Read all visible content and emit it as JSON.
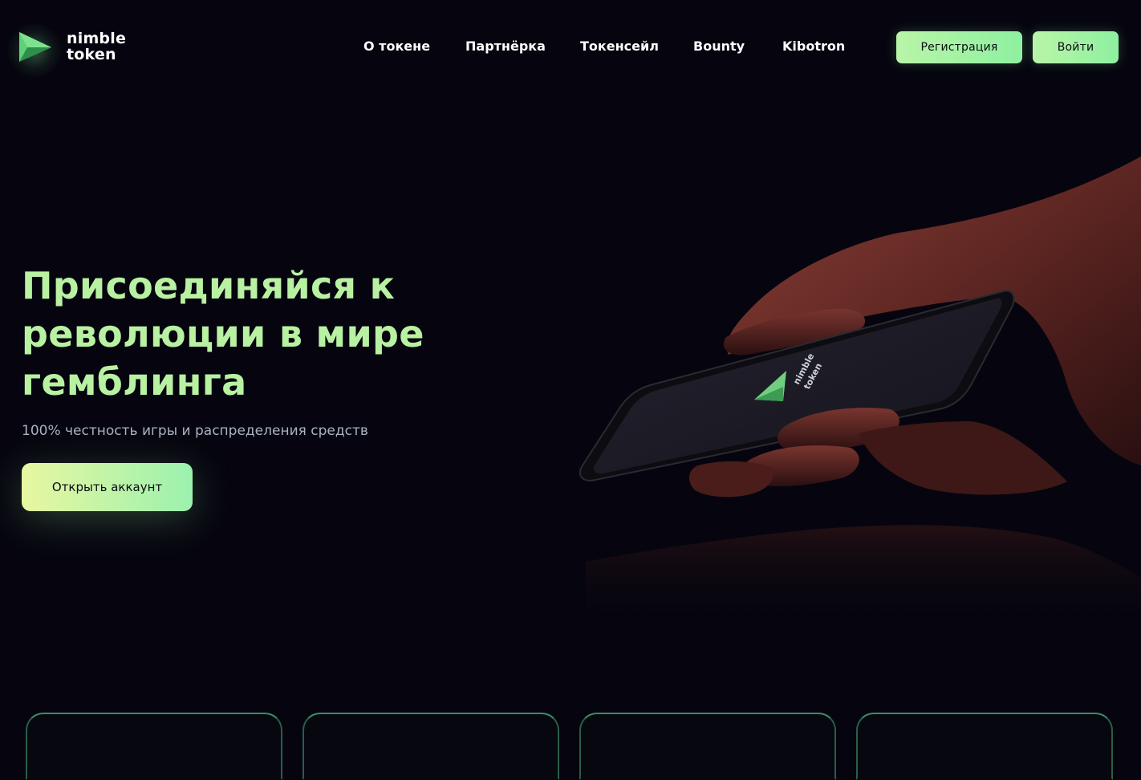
{
  "brand": {
    "name_line1": "nimble",
    "name_line2": "token",
    "logo_icon": "play-triangle-icon",
    "accent": "#8ef0a0"
  },
  "nav": {
    "items": [
      {
        "label": "О токене"
      },
      {
        "label": "Партнёрка"
      },
      {
        "label": "Токенсейл"
      },
      {
        "label": "Bounty"
      },
      {
        "label": "Kibotron"
      }
    ]
  },
  "auth": {
    "register_label": "Регистрация",
    "login_label": "Войти"
  },
  "hero": {
    "title": "Присоединяйся к революции в мире гемблинга",
    "subtitle": "100% честность игры и распределения средств",
    "cta_label": "Открыть аккаунт",
    "title_color": "#b9f1a2"
  },
  "phone_screen": {
    "logo_line1": "nimble",
    "logo_line2": "token"
  },
  "cards": [
    {},
    {},
    {},
    {}
  ]
}
